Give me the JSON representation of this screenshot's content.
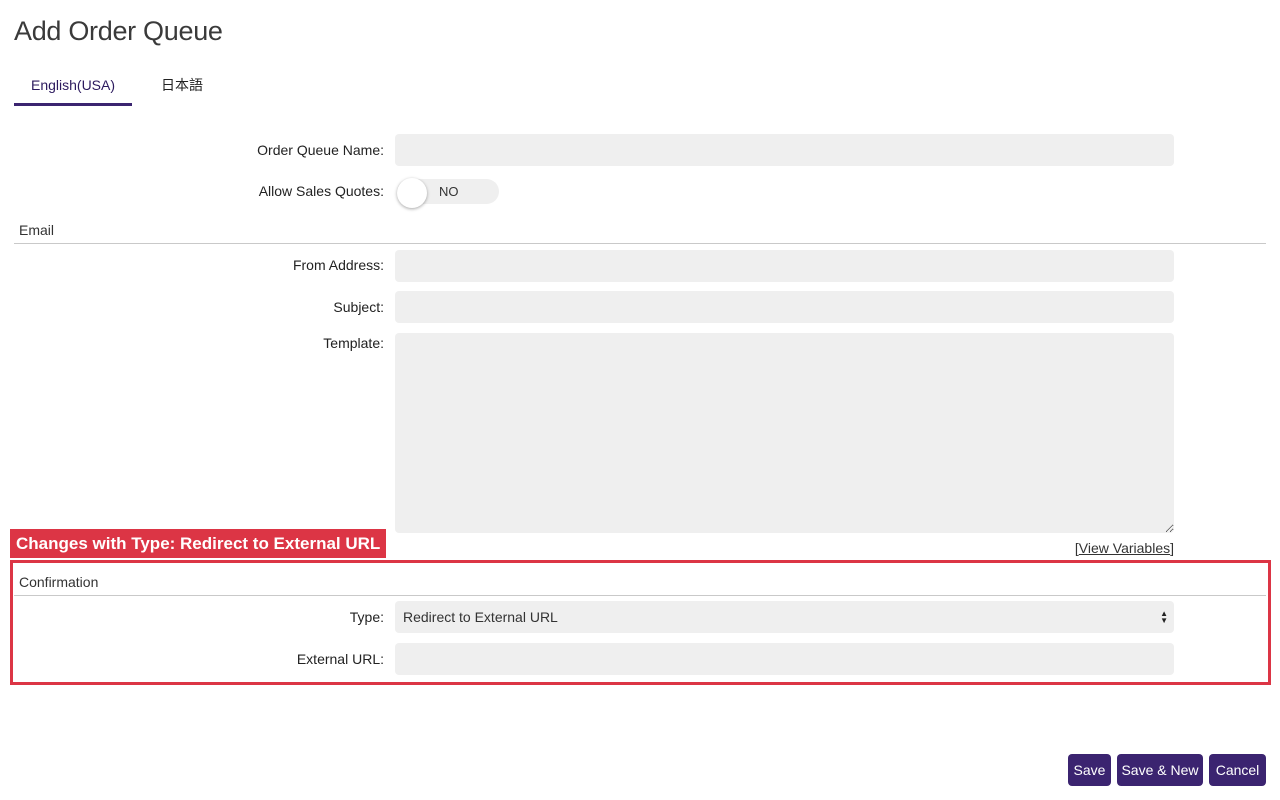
{
  "page": {
    "title": "Add Order Queue"
  },
  "tabs": [
    {
      "label": "English(USA)",
      "active": true
    },
    {
      "label": "日本語",
      "active": false
    }
  ],
  "form": {
    "order_queue_name": {
      "label": "Order Queue Name:",
      "value": ""
    },
    "allow_sales_quotes": {
      "label": "Allow Sales Quotes:",
      "state": "NO"
    }
  },
  "email_section": {
    "header": "Email",
    "from_address": {
      "label": "From Address:",
      "value": ""
    },
    "subject": {
      "label": "Subject:",
      "value": ""
    },
    "template": {
      "label": "Template:",
      "value": ""
    },
    "view_variables": {
      "open": "[",
      "link": "View Variables",
      "close": "]"
    }
  },
  "annotation": {
    "text": "Changes with Type: Redirect to External URL",
    "color": "#dc3545"
  },
  "confirmation_section": {
    "header": "Confirmation",
    "type": {
      "label": "Type:",
      "selected": "Redirect to External URL"
    },
    "external_url": {
      "label": "External URL:",
      "value": ""
    }
  },
  "actions": {
    "save": "Save",
    "save_new": "Save & New",
    "cancel": "Cancel"
  },
  "colors": {
    "brand": "#3b2470",
    "field_bg": "#efefef",
    "annotation": "#dc3545"
  }
}
